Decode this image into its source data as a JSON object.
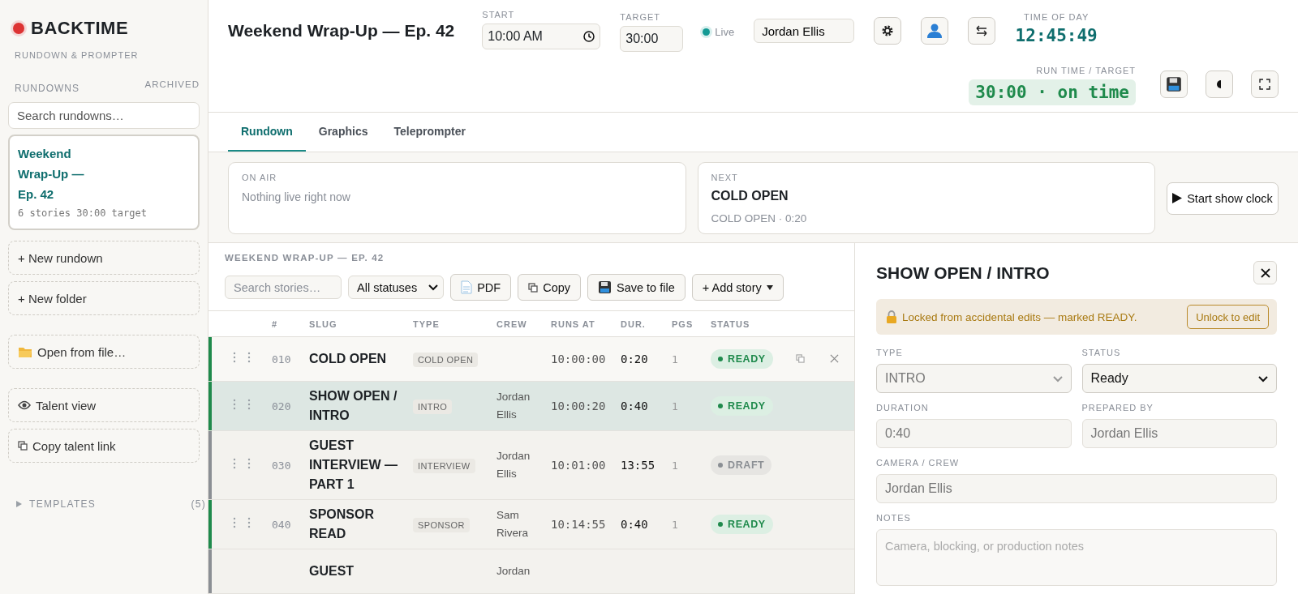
{
  "app": {
    "name": "BACKTIME",
    "tagline": "RUNDOWN & PROMPTER"
  },
  "sidebar": {
    "rundowns_label": "RUNDOWNS",
    "archived_link": "ARCHIVED",
    "search": {
      "placeholder": "Search rundowns…"
    },
    "rundowns": [
      {
        "title": "Weekend Wrap-Up — Ep. 42",
        "meta": "6 stories 30:00 target",
        "selected": true
      }
    ],
    "action_groups": [
      [
        {
          "label": "+ New rundown"
        },
        {
          "label": "+ New folder"
        }
      ],
      [
        {
          "label": "Open from file…"
        }
      ],
      [
        {
          "label": "Talent view"
        },
        {
          "label": "Copy talent link"
        }
      ]
    ],
    "templates": {
      "label": "TEMPLATES",
      "count": "(5)",
      "expanded": false
    }
  },
  "header": {
    "title": "Weekend Wrap-Up — Ep. 42",
    "start": {
      "label": "START",
      "value": "10:00 AM"
    },
    "target": {
      "label": "TARGET",
      "value": "30:00"
    },
    "live": {
      "label": "Live",
      "on": true
    },
    "user": {
      "value": "Jordan Ellis"
    },
    "time_of_day": {
      "label": "TIME OF DAY",
      "value": "12:45:49"
    },
    "run_time": {
      "label": "RUN TIME / TARGET",
      "value": "30:00 · on time"
    }
  },
  "tabs": [
    {
      "label": "Rundown",
      "selected": true
    },
    {
      "label": "Graphics",
      "selected": false
    },
    {
      "label": "Teleprompter",
      "selected": false
    }
  ],
  "on_air": {
    "label": "ON AIR",
    "text": "Nothing live right now"
  },
  "next": {
    "label": "NEXT",
    "title": "COLD OPEN",
    "meta": "COLD OPEN · 0:20"
  },
  "start_button": {
    "label": "Start show clock"
  },
  "table": {
    "title": "WEEKEND WRAP-UP — EP. 42",
    "search": {
      "placeholder": "Search stories…"
    },
    "filter": {
      "value": "All statuses"
    },
    "buttons": [
      {
        "label": "PDF"
      },
      {
        "label": "Copy"
      },
      {
        "label": "Save to file"
      },
      {
        "label": "+ Add story"
      }
    ],
    "columns": [
      "#",
      "SLUG",
      "TYPE",
      "CREW",
      "RUNS AT",
      "DUR.",
      "PGS",
      "STATUS"
    ],
    "rows": [
      {
        "number": "010",
        "slug": "COLD OPEN",
        "type": "COLD OPEN",
        "runs_at": "10:00:00",
        "duration": "0:20",
        "pages": "1",
        "status": "READY",
        "kind": "ready",
        "selected": false,
        "hovered": true
      },
      {
        "number": "020",
        "slug": "SHOW OPEN / INTRO",
        "type": "INTRO",
        "crew": "Jordan Ellis",
        "runs_at": "10:00:20",
        "duration": "0:40",
        "pages": "1",
        "status": "READY",
        "kind": "ready",
        "selected": true,
        "hovered": false
      },
      {
        "number": "030",
        "slug": "GUEST INTERVIEW — PART 1",
        "type": "INTERVIEW",
        "crew": "Jordan Ellis",
        "runs_at": "10:01:00",
        "duration": "13:55",
        "pages": "1",
        "status": "DRAFT",
        "kind": "draft",
        "selected": false,
        "hovered": false
      },
      {
        "number": "040",
        "slug": "SPONSOR READ",
        "type": "SPONSOR",
        "crew": "Sam Rivera",
        "runs_at": "10:14:55",
        "duration": "0:40",
        "pages": "1",
        "status": "READY",
        "kind": "ready",
        "selected": false,
        "hovered": false
      },
      {
        "slug": "GUEST",
        "crew": "Jordan",
        "kind": "draft",
        "selected": false,
        "hovered": false
      }
    ]
  },
  "detail": {
    "title": "SHOW OPEN / INTRO",
    "lock": {
      "locked": true,
      "text": "Locked from accidental edits — marked READY.",
      "button": "Unlock to edit"
    },
    "fields": [
      {
        "label": "TYPE",
        "kind": "select",
        "value": "INTRO",
        "disabled": true
      },
      {
        "label": "STATUS",
        "kind": "select",
        "value": "Ready",
        "disabled": false
      },
      {
        "label": "DURATION",
        "kind": "input",
        "value": "0:40",
        "disabled": true
      },
      {
        "label": "PREPARED BY",
        "kind": "input",
        "value": "Jordan Ellis",
        "disabled": true
      },
      {
        "label": "CAMERA / CREW",
        "kind": "wide-input",
        "value": "Jordan Ellis",
        "disabled": true
      },
      {
        "label": "NOTES",
        "kind": "textarea",
        "placeholder": "Camera, blocking, or production notes",
        "disabled": false
      }
    ]
  }
}
